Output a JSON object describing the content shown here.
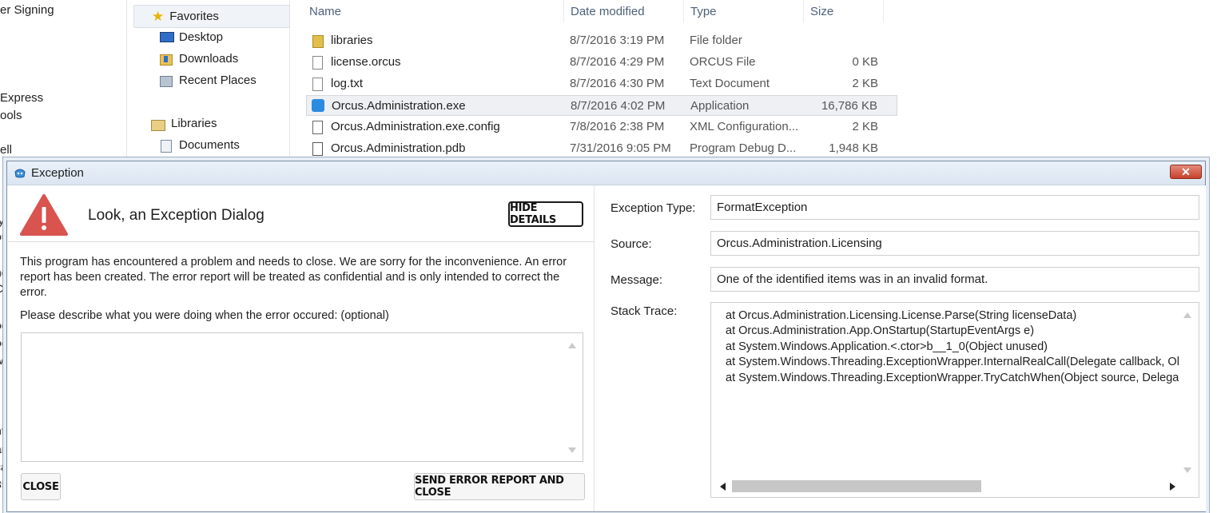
{
  "explorer": {
    "left_fragments": [
      "er Signing",
      "Express",
      "ools",
      "ell",
      "y",
      "ou",
      "ng",
      "Ce",
      "oo",
      "oo",
      "w",
      "t",
      "nt",
      "an",
      "ca",
      "35"
    ],
    "nav": {
      "favorites": "Favorites",
      "desktop": "Desktop",
      "downloads": "Downloads",
      "recent_places": "Recent Places",
      "libraries": "Libraries",
      "documents": "Documents"
    },
    "columns": {
      "name": "Name",
      "date": "Date modified",
      "type": "Type",
      "size": "Size"
    },
    "files": [
      {
        "name": "libraries",
        "date": "8/7/2016 3:19 PM",
        "type": "File folder",
        "size": "",
        "icon": "folder-icon"
      },
      {
        "name": "license.orcus",
        "date": "8/7/2016 4:29 PM",
        "type": "ORCUS File",
        "size": "0 KB",
        "icon": "file-icon"
      },
      {
        "name": "log.txt",
        "date": "8/7/2016 4:30 PM",
        "type": "Text Document",
        "size": "2 KB",
        "icon": "text-file-icon"
      },
      {
        "name": "Orcus.Administration.exe",
        "date": "8/7/2016 4:02 PM",
        "type": "Application",
        "size": "16,786 KB",
        "icon": "app-icon"
      },
      {
        "name": "Orcus.Administration.exe.config",
        "date": "7/8/2016 2:38 PM",
        "type": "XML Configuration...",
        "size": "2 KB",
        "icon": "config-file-icon"
      },
      {
        "name": "Orcus.Administration.pdb",
        "date": "7/31/2016 9:05 PM",
        "type": "Program Debug D...",
        "size": "1,948 KB",
        "icon": "pdb-file-icon"
      }
    ]
  },
  "dialog": {
    "title": "Exception",
    "close_glyph": "✕",
    "heading": "Look, an Exception Dialog",
    "hide_details_label": "HIDE DETAILS",
    "description": "This program has encountered a problem and needs to close. We are sorry for the inconvenience. An error report has been created. The error report will be treated as confidential and is only intended to correct the error.",
    "prompt": "Please describe what you were doing when the error occured: (optional)",
    "user_description_value": "",
    "close_label": "CLOSE",
    "send_label": "SEND ERROR REPORT AND CLOSE",
    "details": {
      "exception_type_label": "Exception Type:",
      "exception_type": "FormatException",
      "source_label": "Source:",
      "source": "Orcus.Administration.Licensing",
      "message_label": "Message:",
      "message": "One of the identified items was in an invalid format.",
      "stack_trace_label": "Stack Trace:",
      "stack_trace": [
        "at Orcus.Administration.Licensing.License.Parse(String licenseData)",
        "at Orcus.Administration.App.OnStartup(StartupEventArgs e)",
        "at System.Windows.Application.<.ctor>b__1_0(Object unused)",
        "at System.Windows.Threading.ExceptionWrapper.InternalRealCall(Delegate callback, Ol",
        "at System.Windows.Threading.ExceptionWrapper.TryCatchWhen(Object source, Delega"
      ]
    }
  },
  "colors": {
    "warning_red": "#d9534f",
    "titlebar": "#dbe5f1",
    "close_button": "#c7402b"
  }
}
